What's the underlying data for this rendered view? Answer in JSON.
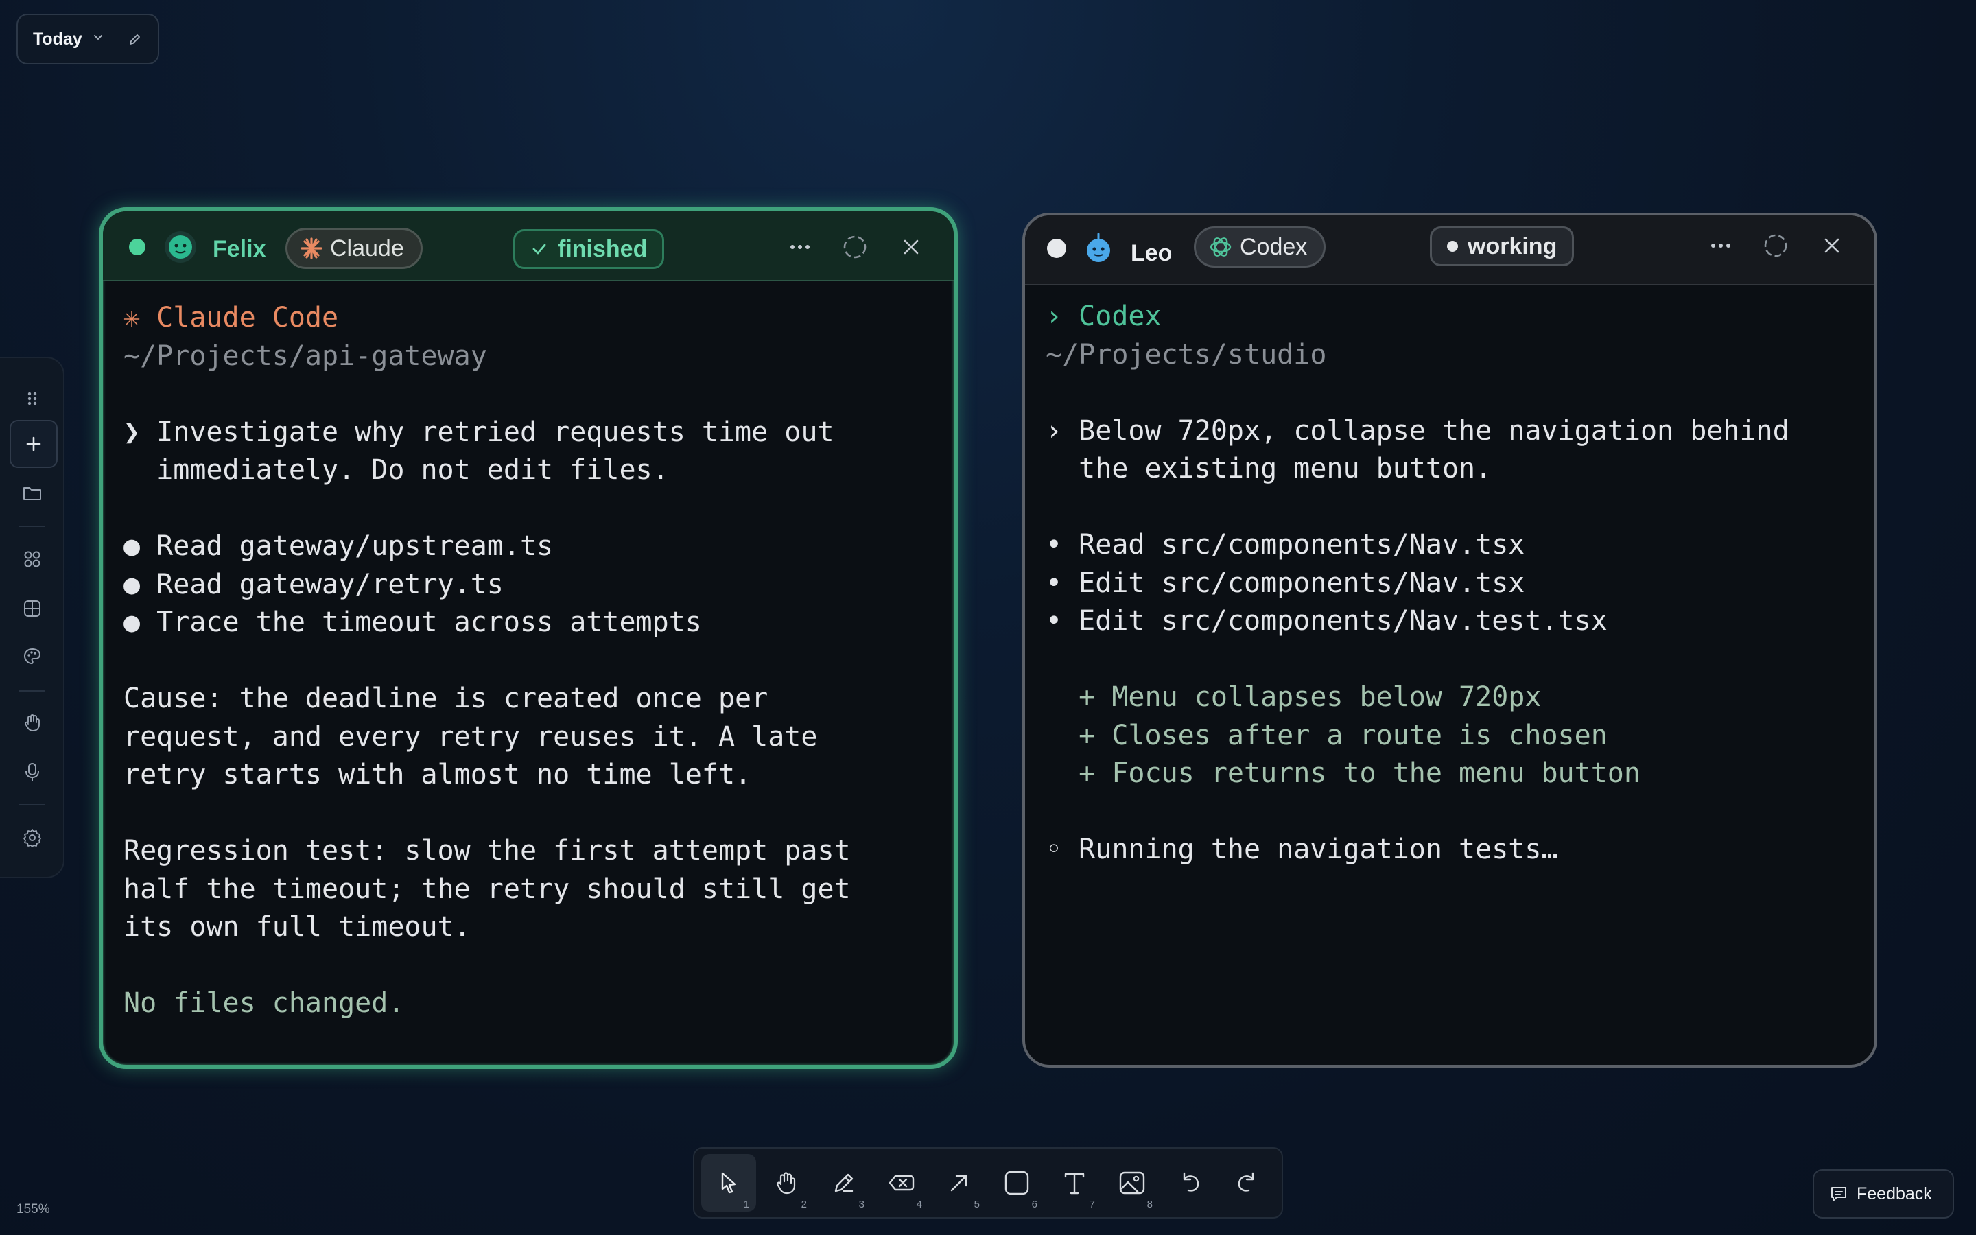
{
  "header": {
    "date_label": "Today"
  },
  "windows": {
    "felix": {
      "agent_name": "Felix",
      "model_chip": "Claude",
      "status": "finished",
      "lines": [
        {
          "text": "✳ Claude Code",
          "cls": "c-orange"
        },
        {
          "text": "~/Projects/api-gateway",
          "cls": "c-gray"
        },
        {
          "text": "",
          "cls": ""
        },
        {
          "text": "❯ Investigate why retried requests time out",
          "cls": ""
        },
        {
          "text": "  immediately. Do not edit files.",
          "cls": ""
        },
        {
          "text": "",
          "cls": ""
        },
        {
          "text": "● Read gateway/upstream.ts",
          "cls": ""
        },
        {
          "text": "● Read gateway/retry.ts",
          "cls": ""
        },
        {
          "text": "● Trace the timeout across attempts",
          "cls": ""
        },
        {
          "text": "",
          "cls": ""
        },
        {
          "text": "Cause: the deadline is created once per",
          "cls": ""
        },
        {
          "text": "request, and every retry reuses it. A late",
          "cls": ""
        },
        {
          "text": "retry starts with almost no time left.",
          "cls": ""
        },
        {
          "text": "",
          "cls": ""
        },
        {
          "text": "Regression test: slow the first attempt past",
          "cls": ""
        },
        {
          "text": "half the timeout; the retry should still get",
          "cls": ""
        },
        {
          "text": "its own full timeout.",
          "cls": ""
        },
        {
          "text": "",
          "cls": ""
        },
        {
          "text": "No files changed.",
          "cls": "c-sage"
        }
      ]
    },
    "leo": {
      "agent_name": "Leo",
      "model_chip": "Codex",
      "status": "working",
      "lines": [
        {
          "text": "› Codex",
          "cls": "c-green"
        },
        {
          "text": "~/Projects/studio",
          "cls": "c-gray"
        },
        {
          "text": "",
          "cls": ""
        },
        {
          "text": "› Below 720px, collapse the navigation behind",
          "cls": ""
        },
        {
          "text": "  the existing menu button.",
          "cls": ""
        },
        {
          "text": "",
          "cls": ""
        },
        {
          "text": "• Read src/components/Nav.tsx",
          "cls": ""
        },
        {
          "text": "• Edit src/components/Nav.tsx",
          "cls": ""
        },
        {
          "text": "• Edit src/components/Nav.test.tsx",
          "cls": ""
        },
        {
          "text": "",
          "cls": ""
        },
        {
          "text": "  + Menu collapses below 720px",
          "cls": "c-sage"
        },
        {
          "text": "  + Closes after a route is chosen",
          "cls": "c-sage"
        },
        {
          "text": "  + Focus returns to the menu button",
          "cls": "c-sage"
        },
        {
          "text": "",
          "cls": ""
        },
        {
          "text": "◦ Running the navigation tests…",
          "cls": ""
        }
      ]
    }
  },
  "sidebar_tools": [
    "grip-icon",
    "plus-icon",
    "folder-icon",
    "components-icon",
    "grid-icon",
    "palette-icon",
    "hand-icon",
    "microphone-icon",
    "settings-icon"
  ],
  "bottom_toolbar": {
    "tools": [
      {
        "name": "select-tool",
        "num": "1"
      },
      {
        "name": "hand-tool",
        "num": "2"
      },
      {
        "name": "pencil-tool",
        "num": "3"
      },
      {
        "name": "eraser-tool",
        "num": "4"
      },
      {
        "name": "arrow-tool",
        "num": "5"
      },
      {
        "name": "rectangle-tool",
        "num": "6"
      },
      {
        "name": "text-tool",
        "num": "7"
      },
      {
        "name": "image-tool",
        "num": "8"
      }
    ]
  },
  "zoom_label": "155%",
  "feedback_label": "Feedback",
  "colors": {
    "accent_green": "#3fa27b",
    "status_finished": "#4fc39a",
    "claude_orange": "#e98a62",
    "codex_green": "#4fc39a",
    "leo_avatar": "#4aa8ea"
  }
}
